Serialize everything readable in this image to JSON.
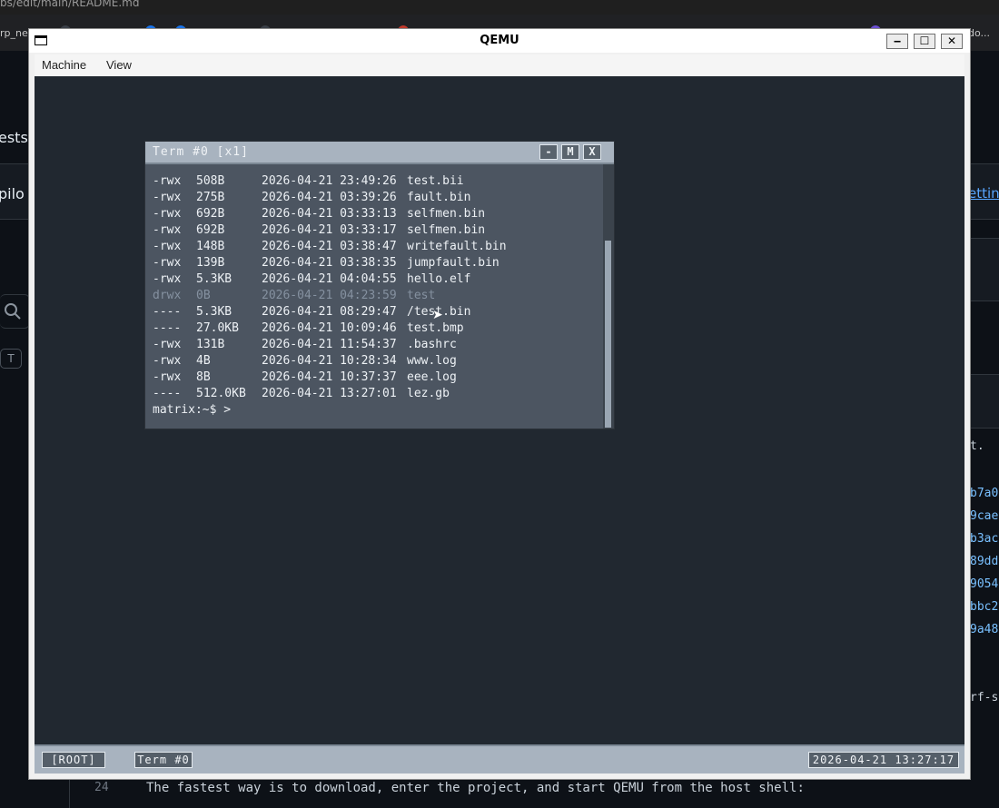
{
  "background": {
    "url_fragment": "bs/edit/main/README.md",
    "bookmark_left": "rp_ne",
    "bookmark_right": "do...",
    "sidebar_tests": "ests",
    "sidebar_copilot": "pilo",
    "search_icon": "search-icon",
    "shortcut_key": "T",
    "right_settings": "etting",
    "right_texts": [
      "t.",
      "b7a0",
      "9cae",
      "b3ac",
      "89dd",
      "9054",
      "bbc2",
      "9a48",
      "rf-s"
    ],
    "editor_line_number": "24",
    "editor_line_text": "The fastest way is to download, enter the project, and start QEMU from the host shell:"
  },
  "qemu": {
    "title": "QEMU",
    "window_controls": {
      "minimize": "‒",
      "maximize": "☐",
      "close": "✕"
    },
    "menu": [
      "Machine",
      "View"
    ]
  },
  "terminal": {
    "title": "Term #0 [x1]",
    "buttons": [
      "-",
      "M",
      "X"
    ],
    "rows": [
      {
        "perm": "-rwx",
        "size": "508B",
        "date": "2026-04-21 23:49:26",
        "name": "test.bii"
      },
      {
        "perm": "-rwx",
        "size": "275B",
        "date": "2026-04-21 03:39:26",
        "name": "fault.bin"
      },
      {
        "perm": "-rwx",
        "size": "692B",
        "date": "2026-04-21 03:33:13",
        "name": "selfmen.bin"
      },
      {
        "perm": "-rwx",
        "size": "692B",
        "date": "2026-04-21 03:33:17",
        "name": "selfmen.bin"
      },
      {
        "perm": "-rwx",
        "size": "148B",
        "date": "2026-04-21 03:38:47",
        "name": "writefault.bin"
      },
      {
        "perm": "-rwx",
        "size": "139B",
        "date": "2026-04-21 03:38:35",
        "name": "jumpfault.bin"
      },
      {
        "perm": "-rwx",
        "size": "5.3KB",
        "date": "2026-04-21 04:04:55",
        "name": "hello.elf"
      },
      {
        "perm": "drwx",
        "size": "0B",
        "date": "2026-04-21 04:23:59",
        "name": "test"
      },
      {
        "perm": "----",
        "size": "5.3KB",
        "date": "2026-04-21 08:29:47",
        "name": "/test.bin"
      },
      {
        "perm": "----",
        "size": "27.0KB",
        "date": "2026-04-21 10:09:46",
        "name": "test.bmp"
      },
      {
        "perm": "-rwx",
        "size": "131B",
        "date": "2026-04-21 11:54:37",
        "name": ".bashrc"
      },
      {
        "perm": "-rwx",
        "size": "4B",
        "date": "2026-04-21 10:28:34",
        "name": "www.log"
      },
      {
        "perm": "-rwx",
        "size": "8B",
        "date": "2026-04-21 10:37:37",
        "name": "eee.log"
      },
      {
        "perm": "----",
        "size": "512.0KB",
        "date": "2026-04-21 13:27:01",
        "name": "lez.gb"
      }
    ],
    "prompt": "matrix:~$ >"
  },
  "statusbar": {
    "root": "[ROOT]",
    "tab": "Term #0",
    "clock": "2026-04-21 13:27:17"
  }
}
